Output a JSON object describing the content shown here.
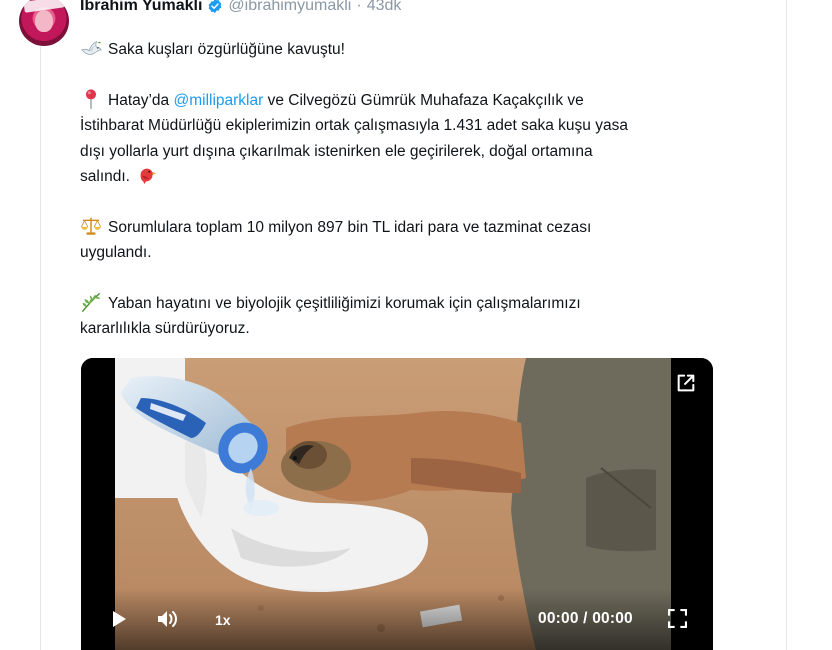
{
  "author": {
    "name": "İbrahim Yumaklı",
    "handle": "@ibrahimyumakli",
    "separator": "·",
    "time": "43dk",
    "verified_icon": "verified-badge-icon"
  },
  "tweet": {
    "line1": {
      "icon": "dove-icon",
      "text": "Saka kuşları özgürlüğüne kavuştu!"
    },
    "para2": {
      "icon": "pushpin-icon",
      "prefix": "Hatay’da ",
      "mention": "@milliparklar",
      "line_a_rest": " ve Cilvegözü Gümrük Muhafaza Kaçakçılık ve",
      "line_b": "İstihbarat Müdürlüğü ekiplerimizin ortak çalışmasıyla 1.431 adet saka kuşu yasa",
      "line_c": "dışı yollarla yurt dışına çıkarılmak istenirken ele geçirilerek, doğal ortamına",
      "line_d": "salındı.",
      "trailing_icon": "bird-icon"
    },
    "para3": {
      "icon": "scales-icon",
      "line_a": "Sorumlulara toplam 10 milyon 897 bin TL idari para ve tazminat cezası",
      "line_b": "uygulandı."
    },
    "para4": {
      "icon": "herb-icon",
      "line_a": "Yaban hayatını ve biyolojik çeşitliliğimizi korumak için çalışmalarımızı",
      "line_b": "kararlılıkla sürdürüyoruz."
    }
  },
  "video": {
    "speed": "1x",
    "current_time": "00:00",
    "time_separator": " / ",
    "duration": "00:00",
    "icons": [
      "expand-icon",
      "play-icon",
      "volume-icon",
      "fullscreen-icon"
    ]
  },
  "colors": {
    "link": "#1d9bf0",
    "muted": "#8b98a5",
    "verified": "#1d9bf0"
  }
}
